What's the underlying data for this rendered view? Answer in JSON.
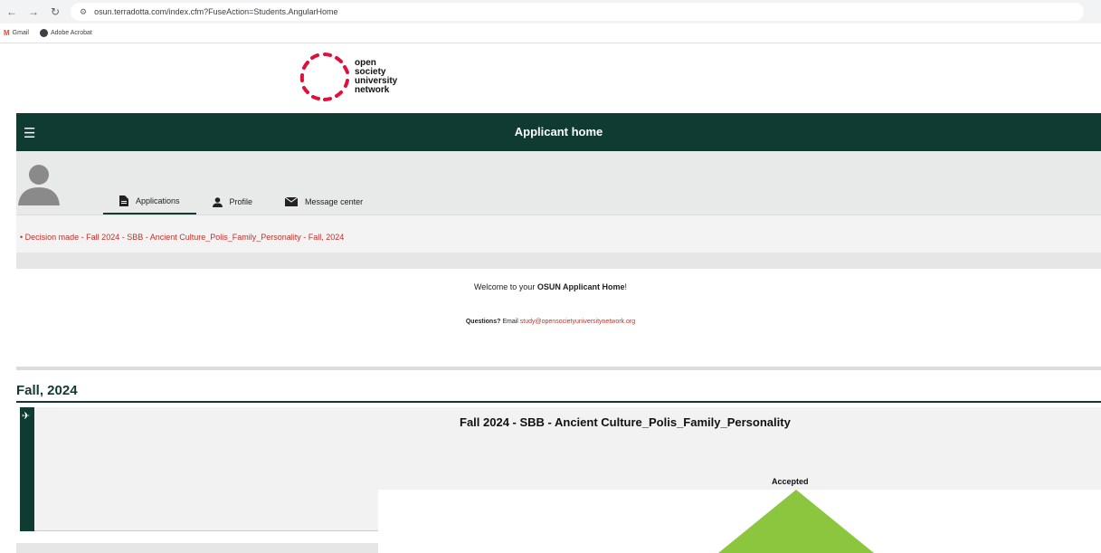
{
  "browser": {
    "url": "osun.terradotta.com/index.cfm?FuseAction=Students.AngularHome",
    "bookmarks": [
      {
        "label": "Gmail",
        "icon": "gmail-icon"
      },
      {
        "label": "Adobe Acrobat",
        "icon": "acrobat-icon"
      }
    ]
  },
  "logo": {
    "lines": [
      "open",
      "society",
      "university",
      "network"
    ],
    "accent_color": "#e0103c"
  },
  "header": {
    "title": "Applicant home",
    "bg_color": "#0f3b33"
  },
  "tabs": [
    {
      "label": "Applications",
      "icon": "document-icon",
      "active": true
    },
    {
      "label": "Profile",
      "icon": "person-icon",
      "active": false
    },
    {
      "label": "Message center",
      "icon": "envelope-icon",
      "active": false
    }
  ],
  "decision_notice": "Decision made - Fall 2024 - SBB - Ancient Culture_Polis_Family_Personality - Fall, 2024",
  "welcome": {
    "prefix": "Welcome to your ",
    "bold": "OSUN Applicant Home",
    "suffix": "!"
  },
  "questions": {
    "bold": "Questions?",
    "text": " Email ",
    "email": "study@opensocietyuniversitynetwork.org"
  },
  "term": {
    "title": "Fall, 2024",
    "application": {
      "title": "Fall 2024 - SBB - Ancient Culture_Polis_Family_Personality",
      "status": "Accepted",
      "status_color": "#8cc63f",
      "icon": "airplane-icon"
    }
  }
}
